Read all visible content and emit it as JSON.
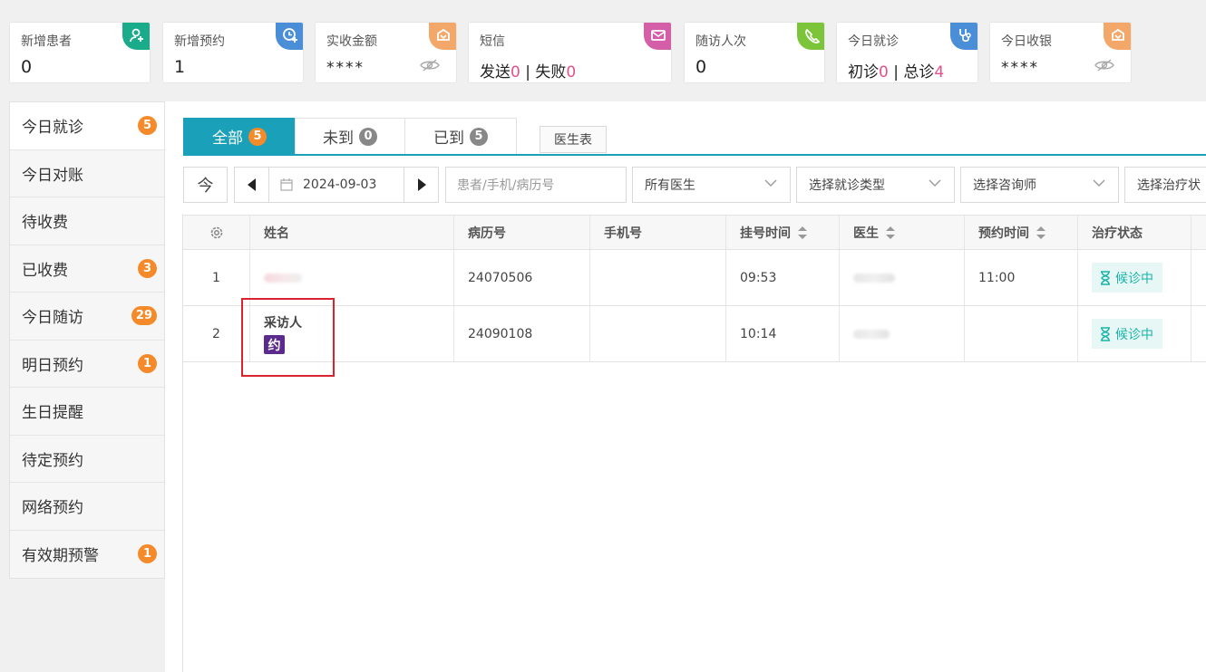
{
  "stats": [
    {
      "label": "新增患者",
      "value": "0",
      "corner_color": "#1aab8a",
      "icon": "user-plus-icon"
    },
    {
      "label": "新增预约",
      "value": "1",
      "corner_color": "#4a8ed8",
      "icon": "clock-plus-icon"
    },
    {
      "label": "实收金额",
      "value": "****",
      "corner_color": "#f3a86a",
      "icon": "wallet-icon",
      "hidden_toggle": "eye-off-icon"
    },
    {
      "label": "短信",
      "parts": {
        "a": "发送",
        "a_val": "0",
        "sep": " | ",
        "b": "失败",
        "b_val": "0"
      },
      "corner_color": "#d45ea7",
      "icon": "mail-icon"
    },
    {
      "label": "随访人次",
      "value": "0",
      "corner_color": "#7cc43a",
      "icon": "phone-icon"
    },
    {
      "label": "今日就诊",
      "parts": {
        "a": "初诊",
        "a_val": "0",
        "sep": " | ",
        "b": "总诊",
        "b_val": "4"
      },
      "corner_color": "#4a8ed8",
      "icon": "stethoscope-icon"
    },
    {
      "label": "今日收银",
      "value": "****",
      "corner_color": "#f3a86a",
      "icon": "wallet-icon",
      "hidden_toggle": "eye-off-icon"
    }
  ],
  "sidebar": {
    "items": [
      {
        "label": "今日就诊",
        "badge": "5"
      },
      {
        "label": "今日对账",
        "badge": ""
      },
      {
        "label": "待收费",
        "badge": ""
      },
      {
        "label": "已收费",
        "badge": "3"
      },
      {
        "label": "今日随访",
        "badge": "29"
      },
      {
        "label": "明日预约",
        "badge": "1"
      },
      {
        "label": "生日提醒",
        "badge": ""
      },
      {
        "label": "待定预约",
        "badge": ""
      },
      {
        "label": "网络预约",
        "badge": ""
      },
      {
        "label": "有效期预警",
        "badge": "1"
      }
    ]
  },
  "tabs": [
    {
      "label": "全部",
      "badge": "5"
    },
    {
      "label": "未到",
      "badge": "0"
    },
    {
      "label": "已到",
      "badge": "5"
    }
  ],
  "doctor_table_button": "医生表",
  "filters": {
    "today_button": "今",
    "date": "2024-09-03",
    "search_placeholder": "患者/手机/病历号",
    "doctor_select": "所有医生",
    "visit_type_select": "选择就诊类型",
    "consultant_select": "选择咨询师",
    "treatment_select": "选择治疗状"
  },
  "table": {
    "headers": {
      "name": "姓名",
      "record_no": "病历号",
      "phone": "手机号",
      "reg_time": "挂号时间",
      "doctor": "医生",
      "appt_time": "预约时间",
      "status": "治疗状态"
    },
    "rows": [
      {
        "index": "1",
        "name": "",
        "tag": "",
        "record_no": "24070506",
        "phone": "",
        "reg_time": "09:53",
        "doctor": "",
        "appt_time": "11:00",
        "status": "候诊中"
      },
      {
        "index": "2",
        "name": "采访人",
        "tag": "约",
        "record_no": "24090108",
        "phone": "",
        "reg_time": "10:14",
        "doctor": "",
        "appt_time": "",
        "status": "候诊中"
      }
    ]
  },
  "colors": {
    "accent": "#1aa0b9",
    "badge_orange": "#f58a2a",
    "highlight_pink": "#e5508a",
    "status_green": "#1bb4a8",
    "appointment_purple": "#5a2a8c",
    "annotation_red": "#d9232e"
  }
}
